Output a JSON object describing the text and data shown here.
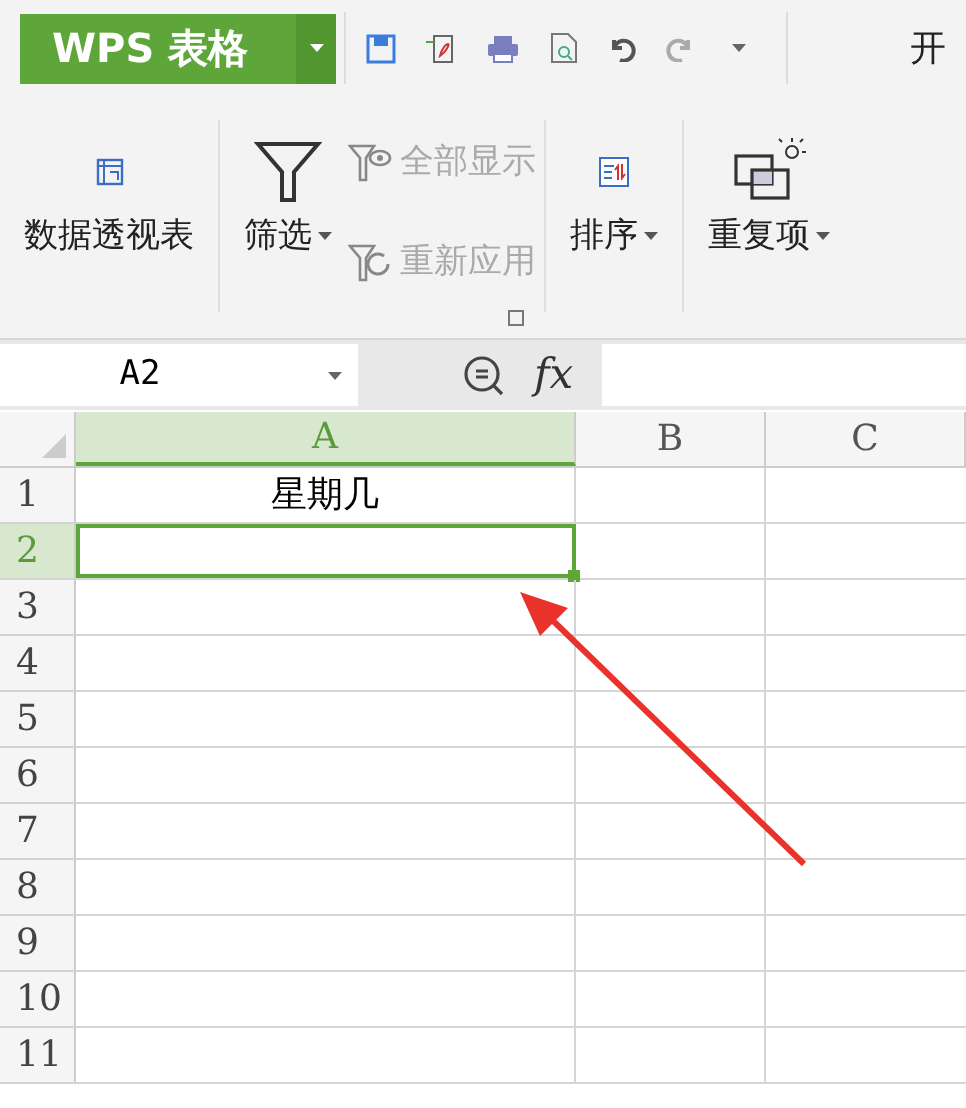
{
  "app_button": {
    "label": "WPS 表格"
  },
  "menu_tabs": [
    {
      "label": "开",
      "selected": false
    }
  ],
  "ribbon": {
    "groups": [
      {
        "items": [
          {
            "kind": "large",
            "label": "数据透视表",
            "dropdown": false,
            "disabled": false
          }
        ]
      },
      {
        "items": [
          {
            "kind": "large",
            "label": "筛选",
            "dropdown": true,
            "disabled": false
          },
          {
            "kind": "small",
            "label": "全部显示",
            "disabled": true
          },
          {
            "kind": "small",
            "label": "重新应用",
            "disabled": true
          }
        ],
        "launcher": true
      },
      {
        "items": [
          {
            "kind": "large",
            "label": "排序",
            "dropdown": true,
            "disabled": false
          }
        ]
      },
      {
        "items": [
          {
            "kind": "large",
            "label": "重复项",
            "dropdown": true,
            "disabled": false
          }
        ]
      }
    ]
  },
  "name_box": {
    "value": "A2"
  },
  "formula_bar": {
    "fx_label": "fx"
  },
  "columns": [
    {
      "label": "A",
      "selected": true
    },
    {
      "label": "B",
      "selected": false
    },
    {
      "label": "C",
      "selected": false
    }
  ],
  "rows": [
    {
      "label": "1",
      "selected": false,
      "cell_a": "星期几"
    },
    {
      "label": "2",
      "selected": true
    },
    {
      "label": "3",
      "selected": false
    },
    {
      "label": "4",
      "selected": false
    },
    {
      "label": "5",
      "selected": false
    },
    {
      "label": "6",
      "selected": false
    },
    {
      "label": "7",
      "selected": false
    },
    {
      "label": "8",
      "selected": false
    },
    {
      "label": "9",
      "selected": false
    },
    {
      "label": "10",
      "selected": false
    },
    {
      "label": "11",
      "selected": false
    }
  ]
}
